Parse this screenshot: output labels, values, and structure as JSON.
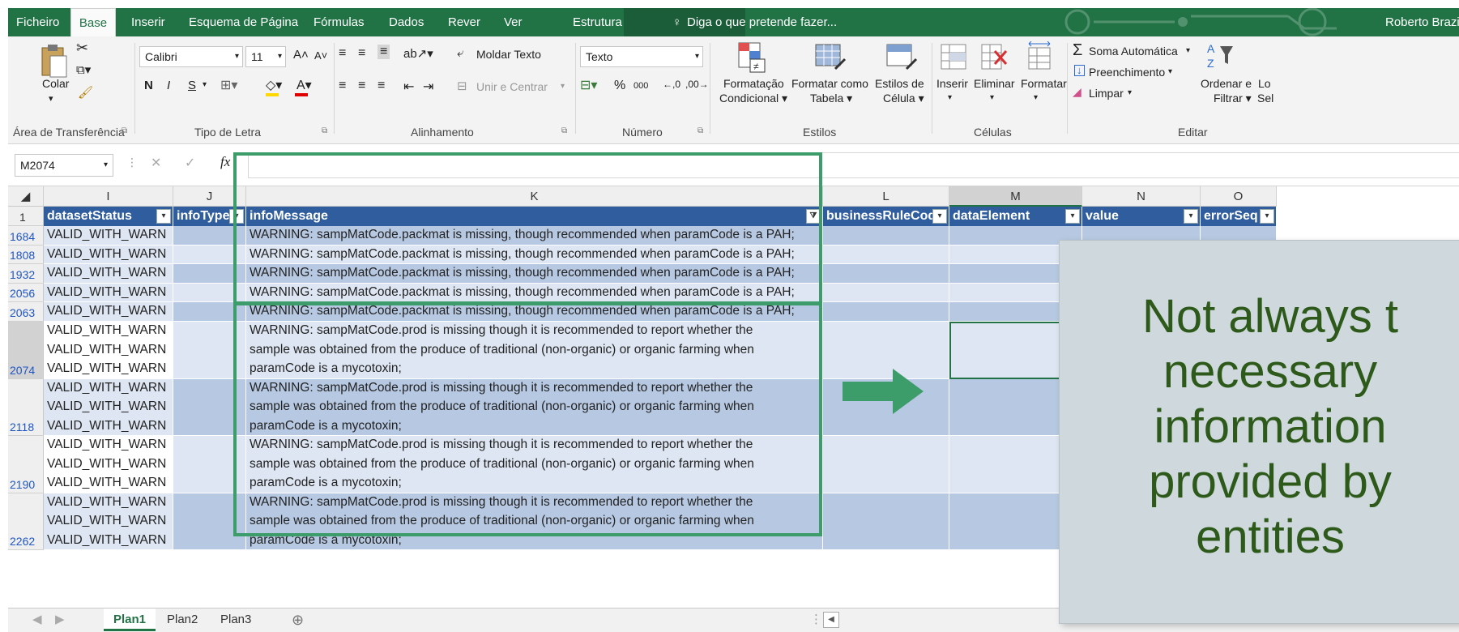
{
  "ribbon_tabs": {
    "file": "Ficheiro",
    "home": "Base",
    "insert": "Inserir",
    "layout": "Esquema de Página",
    "formulas": "Fórmulas",
    "data": "Dados",
    "review": "Rever",
    "view": "Ver",
    "design": "Estrutura",
    "tell_me": "Diga o que pretende fazer...",
    "user": "Roberto Brazi"
  },
  "clipboard": {
    "paste": "Colar",
    "label": "Área de Transferência"
  },
  "font": {
    "name": "Calibri",
    "size": "11",
    "bold": "N",
    "italic": "I",
    "underline": "S",
    "label": "Tipo de Letra"
  },
  "alignment": {
    "wrap": "Moldar Texto",
    "merge": "Unir e Centrar",
    "label": "Alinhamento"
  },
  "number": {
    "format": "Texto",
    "percent": "%",
    "thousands": "000",
    "inc_dec": "⁺⁰.₀₀",
    "dec_dec": ",⁰⁰",
    "label": "Número"
  },
  "styles": {
    "conditional_1": "Formatação",
    "conditional_2": "Condicional ▾",
    "table_1": "Formatar como",
    "table_2": "Tabela ▾",
    "cell_1": "Estilos de",
    "cell_2": "Célula ▾",
    "label": "Estilos"
  },
  "cells": {
    "insert": "Inserir",
    "delete": "Eliminar",
    "format": "Formatar",
    "label": "Células"
  },
  "editing": {
    "autosum": "Soma Automática",
    "fill": "Preenchimento",
    "clear": "Limpar",
    "sort_1": "Ordenar e",
    "sort_2": "Filtrar ▾",
    "find_1": "Lo",
    "find_2": "Sel",
    "label": "Editar"
  },
  "formula_bar": {
    "name_box": "M2074",
    "fx": "fx",
    "formula": ""
  },
  "columns": [
    "I",
    "J",
    "K",
    "L",
    "M",
    "N",
    "O"
  ],
  "headers": {
    "row_num": "1",
    "datasetStatus": "datasetStatus",
    "infoType": "infoType",
    "infoMessage": "infoMessage",
    "businessRuleCode": "businessRuleCode",
    "dataElement": "dataElement",
    "value": "value",
    "errorSeq": "errorSeq"
  },
  "status_value": "VALID_WITH_WARN",
  "rows_single": [
    {
      "num": "1684",
      "message": "WARNING: sampMatCode.packmat is missing, though recommended when paramCode is a PAH;"
    },
    {
      "num": "1808",
      "message": "WARNING: sampMatCode.packmat is missing, though recommended when paramCode is a PAH;"
    },
    {
      "num": "1932",
      "message": "WARNING: sampMatCode.packmat is missing, though recommended when paramCode is a PAH;"
    },
    {
      "num": "2056",
      "message": "WARNING: sampMatCode.packmat is missing, though recommended when paramCode is a PAH;"
    },
    {
      "num": "2063",
      "message": "WARNING: sampMatCode.packmat is missing, though recommended when paramCode is a PAH;"
    }
  ],
  "rows_multi": [
    {
      "num": "2074",
      "lines": [
        "WARNING: sampMatCode.prod is missing though it is recommended to report whether the",
        "sample was obtained from the produce of traditional (non-organic) or organic farming when",
        "paramCode is a mycotoxin;"
      ]
    },
    {
      "num": "2118",
      "lines": [
        "WARNING: sampMatCode.prod is missing though it is recommended to report whether the",
        "sample was obtained from the produce of traditional (non-organic) or organic farming when",
        "paramCode is a mycotoxin;"
      ]
    },
    {
      "num": "2190",
      "lines": [
        "WARNING: sampMatCode.prod is missing though it is recommended to report whether the",
        "sample was obtained from the produce of traditional (non-organic) or organic farming when",
        "paramCode is a mycotoxin;"
      ]
    },
    {
      "num": "2262",
      "lines": [
        "WARNING: sampMatCode.prod is missing though it is recommended to report whether the",
        "sample was obtained from the produce of traditional (non-organic) or organic farming when",
        "paramCode is a mycotoxin;"
      ]
    }
  ],
  "sheets": [
    "Plan1",
    "Plan2",
    "Plan3"
  ],
  "annotation": {
    "lines": [
      "Not always t",
      "necessary",
      "information",
      "provided by",
      "entities"
    ]
  },
  "colors": {
    "excel_green": "#217346",
    "header_blue": "#2f5d9e",
    "band_light": "#dde6f2",
    "band_dark": "#b7c9e2",
    "annotation_green": "#3c9c6a",
    "callout_text": "#2d5a1a"
  }
}
